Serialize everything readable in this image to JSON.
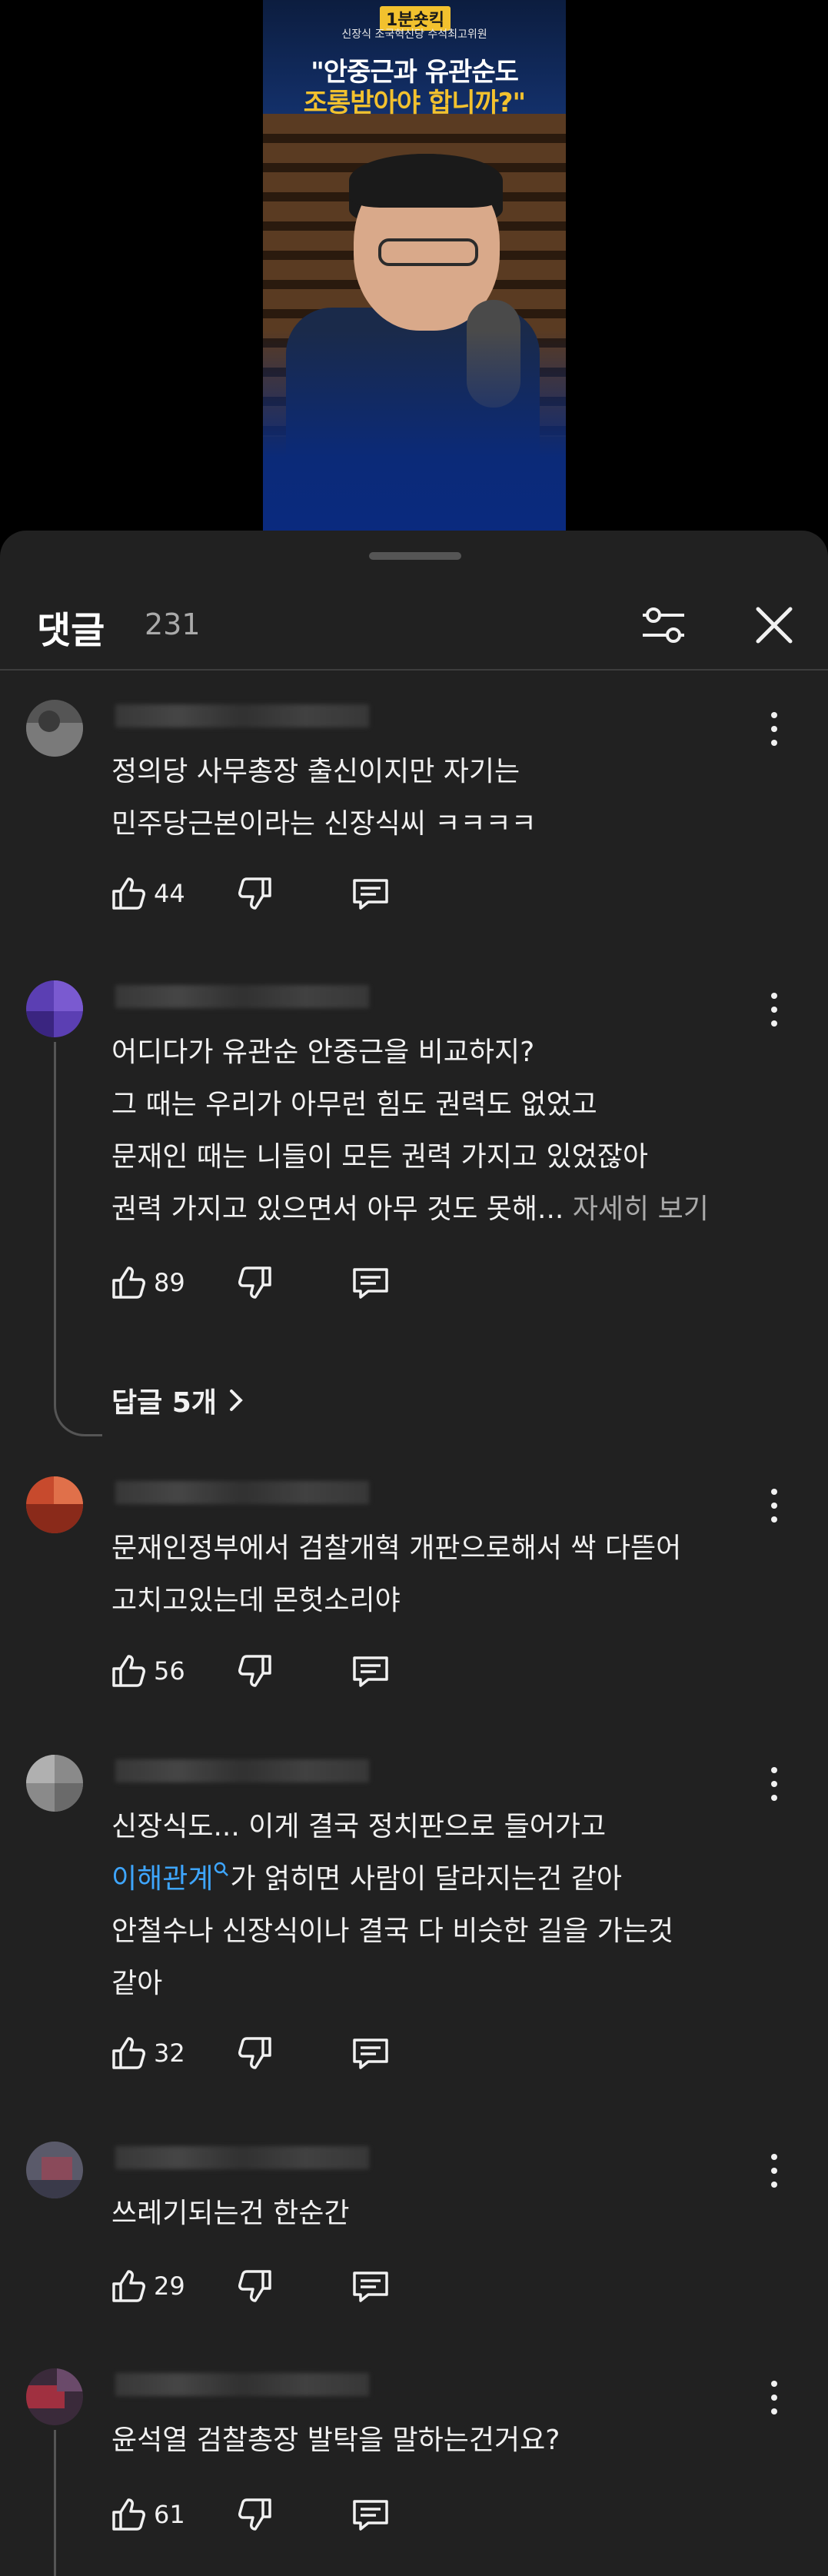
{
  "video": {
    "badge": "1분숏킥",
    "subline": "신장식 조국혁신당 수석최고위원",
    "headline_line1": "\"안중근과 유관순도",
    "headline_line2": "조롱받아야 합니까?\""
  },
  "header": {
    "title": "댓글",
    "count": "231"
  },
  "comments": [
    {
      "lines": [
        "정의당 사무총장 출신이지만 자기는",
        "민주당근본이라는 신장식씨 ㅋㅋㅋㅋ"
      ],
      "likes": "44",
      "avatar_color": "#6f6f6f"
    },
    {
      "lines": [
        "어디다가 유관순 안중근을 비교하지?",
        "그 때는 우리가 아무런 힘도 권력도 없었고",
        "문재인 때는 니들이 모든 권력 가지고 있었잖아",
        "권력 가지고 있으면서 아무 것도 못해..."
      ],
      "read_more": "자세히 보기",
      "likes": "89",
      "replies_label": "답글 5개",
      "avatar_color": "#5b3fb3"
    },
    {
      "lines": [
        "문재인정부에서 검찰개혁 개판으로해서 싹 다뜯어",
        "고치고있는데 몬헛소리야"
      ],
      "likes": "56",
      "avatar_color": "#c74a2d"
    },
    {
      "line1": "신장식도... 이게 결국 정치판으로 들어가고",
      "link_text": "이해관계",
      "line2_rest": "가 얽히면 사람이 달라지는건 같아",
      "lines_after": [
        " 안철수나 신장식이나 결국 다 비슷한 길을 가는것",
        "같아"
      ],
      "likes": "32",
      "avatar_color": "#8a8a8a"
    },
    {
      "lines": [
        "쓰레기되는건 한순간"
      ],
      "likes": "29",
      "avatar_color": "#7a5a6a"
    },
    {
      "lines": [
        "윤석열 검찰총장 발탁을 말하는건거요?"
      ],
      "likes": "61",
      "avatar_color": "#a03040"
    }
  ]
}
